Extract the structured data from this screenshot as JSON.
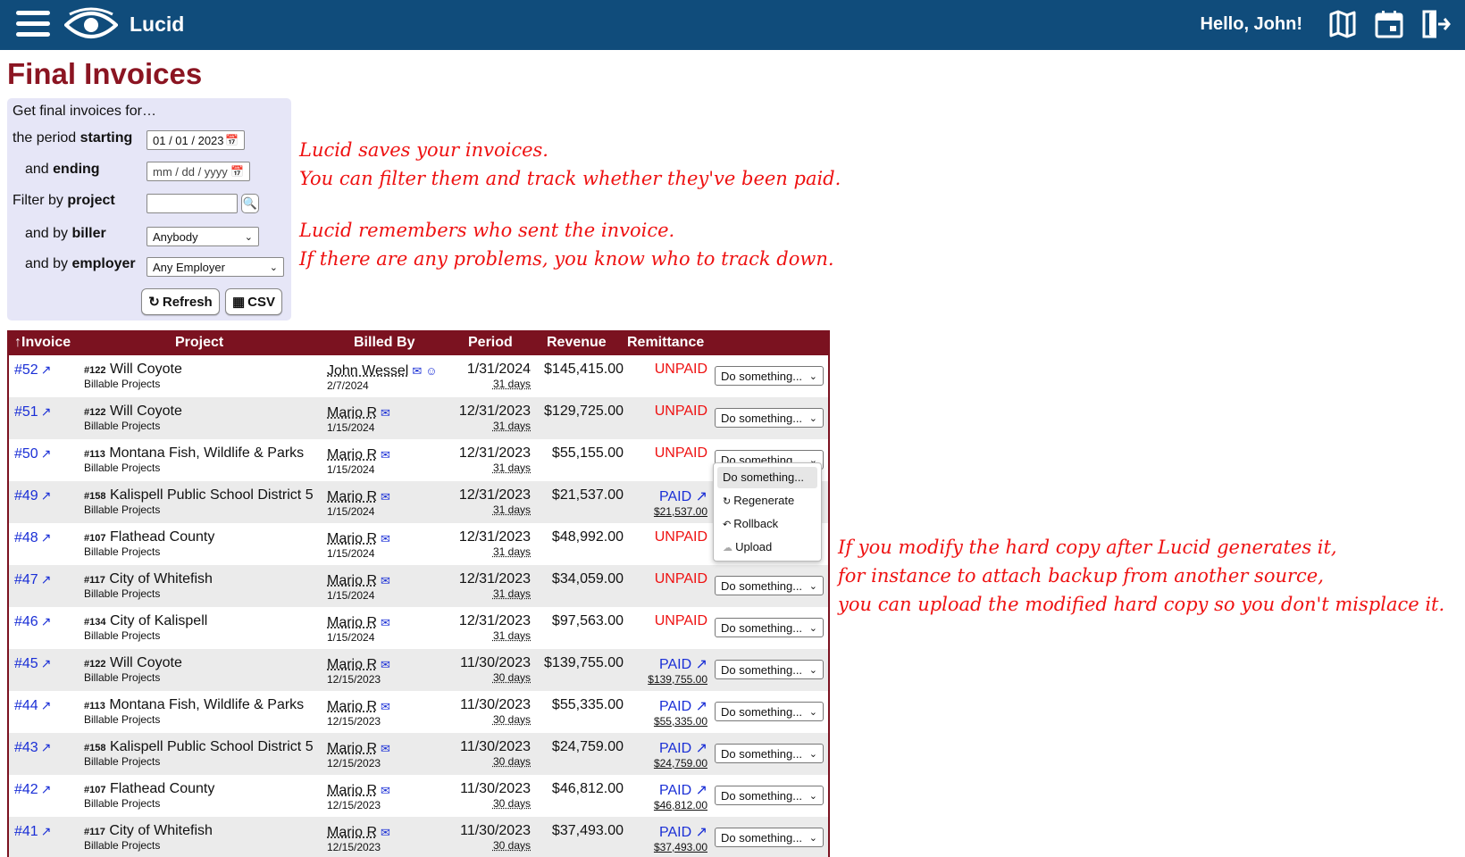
{
  "header": {
    "app_name": "Lucid",
    "greeting": "Hello, John!",
    "icons": [
      "menu-icon",
      "eye-logo-icon",
      "map-icon",
      "calendar-icon",
      "logout-icon"
    ]
  },
  "page_title": "Final Invoices",
  "filter": {
    "intro": "Get final invoices for…",
    "period_prefix": "the period ",
    "period_strong": "starting",
    "start_value": "01 / 01 / 2023",
    "ending_prefix": "and ",
    "ending_strong": "ending",
    "end_placeholder": "mm / dd / yyyy",
    "project_prefix": "Filter by ",
    "project_strong": "project",
    "biller_prefix": "and by ",
    "biller_strong": "biller",
    "biller_value": "Anybody",
    "employer_prefix": "and by ",
    "employer_strong": "employer",
    "employer_value": "Any Employer",
    "refresh_label": "Refresh",
    "csv_label": "CSV"
  },
  "annotations": {
    "a1": [
      "Lucid saves your invoices.",
      "You can filter them and track whether they've been paid."
    ],
    "a2": [
      "Lucid remembers who sent the invoice.",
      "If there are any problems, you know who to track down."
    ],
    "a3": [
      "If you modify the hard copy after Lucid generates it,",
      "for instance to attach backup from another source,",
      "you can upload the modified hard copy so you don't misplace it."
    ]
  },
  "table": {
    "headers": {
      "invoice": "↑Invoice",
      "project": "Project",
      "billed_by": "Billed By",
      "period": "Period",
      "revenue": "Revenue",
      "remittance": "Remittance"
    },
    "action_label": "Do something...",
    "rows": [
      {
        "inv": "#52",
        "pnum": "#122",
        "pname": "Will Coyote",
        "psub": "Billable Projects",
        "biller": "John Wessel",
        "bdate": "2/7/2024",
        "pdate": "1/31/2024",
        "days": "31 days",
        "rev": "$145,415.00",
        "status": "UNPAID",
        "amount": "",
        "smile": true
      },
      {
        "inv": "#51",
        "pnum": "#122",
        "pname": "Will Coyote",
        "psub": "Billable Projects",
        "biller": "Mario R",
        "bdate": "1/15/2024",
        "pdate": "12/31/2023",
        "days": "31 days",
        "rev": "$129,725.00",
        "status": "UNPAID",
        "amount": ""
      },
      {
        "inv": "#50",
        "pnum": "#113",
        "pname": "Montana Fish, Wildlife & Parks",
        "psub": "Billable Projects",
        "biller": "Mario R",
        "bdate": "1/15/2024",
        "pdate": "12/31/2023",
        "days": "31 days",
        "rev": "$55,155.00",
        "status": "UNPAID",
        "amount": ""
      },
      {
        "inv": "#49",
        "pnum": "#158",
        "pname": "Kalispell Public School District 5",
        "psub": "Billable Projects",
        "biller": "Mario R",
        "bdate": "1/15/2024",
        "pdate": "12/31/2023",
        "days": "31 days",
        "rev": "$21,537.00",
        "status": "PAID",
        "amount": "$21,537.00"
      },
      {
        "inv": "#48",
        "pnum": "#107",
        "pname": "Flathead County",
        "psub": "Billable Projects",
        "biller": "Mario R",
        "bdate": "1/15/2024",
        "pdate": "12/31/2023",
        "days": "31 days",
        "rev": "$48,992.00",
        "status": "UNPAID",
        "amount": ""
      },
      {
        "inv": "#47",
        "pnum": "#117",
        "pname": "City of Whitefish",
        "psub": "Billable Projects",
        "biller": "Mario R",
        "bdate": "1/15/2024",
        "pdate": "12/31/2023",
        "days": "31 days",
        "rev": "$34,059.00",
        "status": "UNPAID",
        "amount": ""
      },
      {
        "inv": "#46",
        "pnum": "#134",
        "pname": "City of Kalispell",
        "psub": "Billable Projects",
        "biller": "Mario R",
        "bdate": "1/15/2024",
        "pdate": "12/31/2023",
        "days": "31 days",
        "rev": "$97,563.00",
        "status": "UNPAID",
        "amount": ""
      },
      {
        "inv": "#45",
        "pnum": "#122",
        "pname": "Will Coyote",
        "psub": "Billable Projects",
        "biller": "Mario R",
        "bdate": "12/15/2023",
        "pdate": "11/30/2023",
        "days": "30 days",
        "rev": "$139,755.00",
        "status": "PAID",
        "amount": "$139,755.00"
      },
      {
        "inv": "#44",
        "pnum": "#113",
        "pname": "Montana Fish, Wildlife & Parks",
        "psub": "Billable Projects",
        "biller": "Mario R",
        "bdate": "12/15/2023",
        "pdate": "11/30/2023",
        "days": "30 days",
        "rev": "$55,335.00",
        "status": "PAID",
        "amount": "$55,335.00"
      },
      {
        "inv": "#43",
        "pnum": "#158",
        "pname": "Kalispell Public School District 5",
        "psub": "Billable Projects",
        "biller": "Mario R",
        "bdate": "12/15/2023",
        "pdate": "11/30/2023",
        "days": "30 days",
        "rev": "$24,759.00",
        "status": "PAID",
        "amount": "$24,759.00"
      },
      {
        "inv": "#42",
        "pnum": "#107",
        "pname": "Flathead County",
        "psub": "Billable Projects",
        "biller": "Mario R",
        "bdate": "12/15/2023",
        "pdate": "11/30/2023",
        "days": "30 days",
        "rev": "$46,812.00",
        "status": "PAID",
        "amount": "$46,812.00"
      },
      {
        "inv": "#41",
        "pnum": "#117",
        "pname": "City of Whitefish",
        "psub": "Billable Projects",
        "biller": "Mario R",
        "bdate": "12/15/2023",
        "pdate": "11/30/2023",
        "days": "30 days",
        "rev": "$37,493.00",
        "status": "PAID",
        "amount": "$37,493.00"
      }
    ]
  },
  "dropdown": {
    "items": [
      {
        "label": "Do something...",
        "icon": ""
      },
      {
        "label": "Regenerate",
        "icon": "regenerate-icon"
      },
      {
        "label": "Rollback",
        "icon": "rollback-icon"
      },
      {
        "label": "Upload",
        "icon": "upload-icon"
      }
    ]
  },
  "colors": {
    "header_bg": "#104c7b",
    "title": "#8b1522",
    "table_header": "#7b1220",
    "panel_bg": "#e6e6f7",
    "unpaid": "#ee1111",
    "paid": "#1a2fd6",
    "annotation": "#ee1111"
  }
}
